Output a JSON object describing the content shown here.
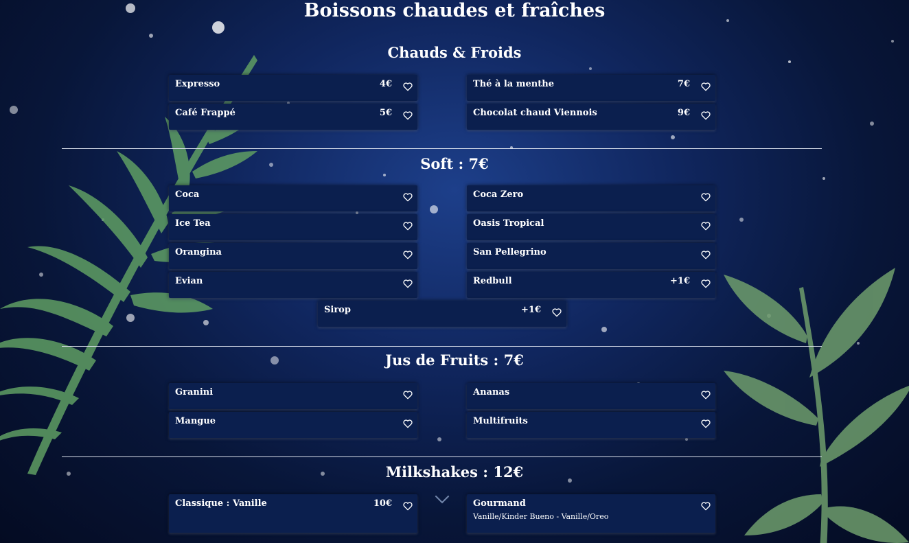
{
  "page": {
    "title": "Boissons chaudes et fraîches"
  },
  "sections": [
    {
      "title": "Chauds & Froids",
      "items": [
        {
          "name": "Expresso",
          "price": "4€"
        },
        {
          "name": "Thé à la menthe",
          "price": "7€"
        },
        {
          "name": "Café Frappé",
          "price": "5€"
        },
        {
          "name": "Chocolat chaud Viennois",
          "price": "9€"
        }
      ]
    },
    {
      "title": "Soft : 7€",
      "items": [
        {
          "name": "Coca"
        },
        {
          "name": "Coca Zero"
        },
        {
          "name": "Ice Tea"
        },
        {
          "name": "Oasis Tropical"
        },
        {
          "name": "Orangina"
        },
        {
          "name": "San Pellegrino"
        },
        {
          "name": "Evian"
        },
        {
          "name": "Redbull",
          "price": "+1€"
        },
        {
          "name": "Sirop",
          "price": "+1€"
        }
      ]
    },
    {
      "title": "Jus de Fruits : 7€",
      "items": [
        {
          "name": "Granini"
        },
        {
          "name": "Ananas"
        },
        {
          "name": "Mangue"
        },
        {
          "name": "Multifruits"
        }
      ]
    },
    {
      "title": "Milkshakes : 12€",
      "items": [
        {
          "name": "Classique : Vanille",
          "price": "10€"
        },
        {
          "name": "Gourmand",
          "description": "Vanille/Kinder Bueno - Vanille/Oreo"
        }
      ]
    }
  ],
  "icons": {
    "favorite": "heart-outline-icon",
    "scroll": "chevron-down-icon"
  },
  "colors": {
    "card_bg": "#0b1f4e",
    "text": "#ffffff",
    "leaf": "#6aa86b",
    "divider": "#dde3ee"
  }
}
